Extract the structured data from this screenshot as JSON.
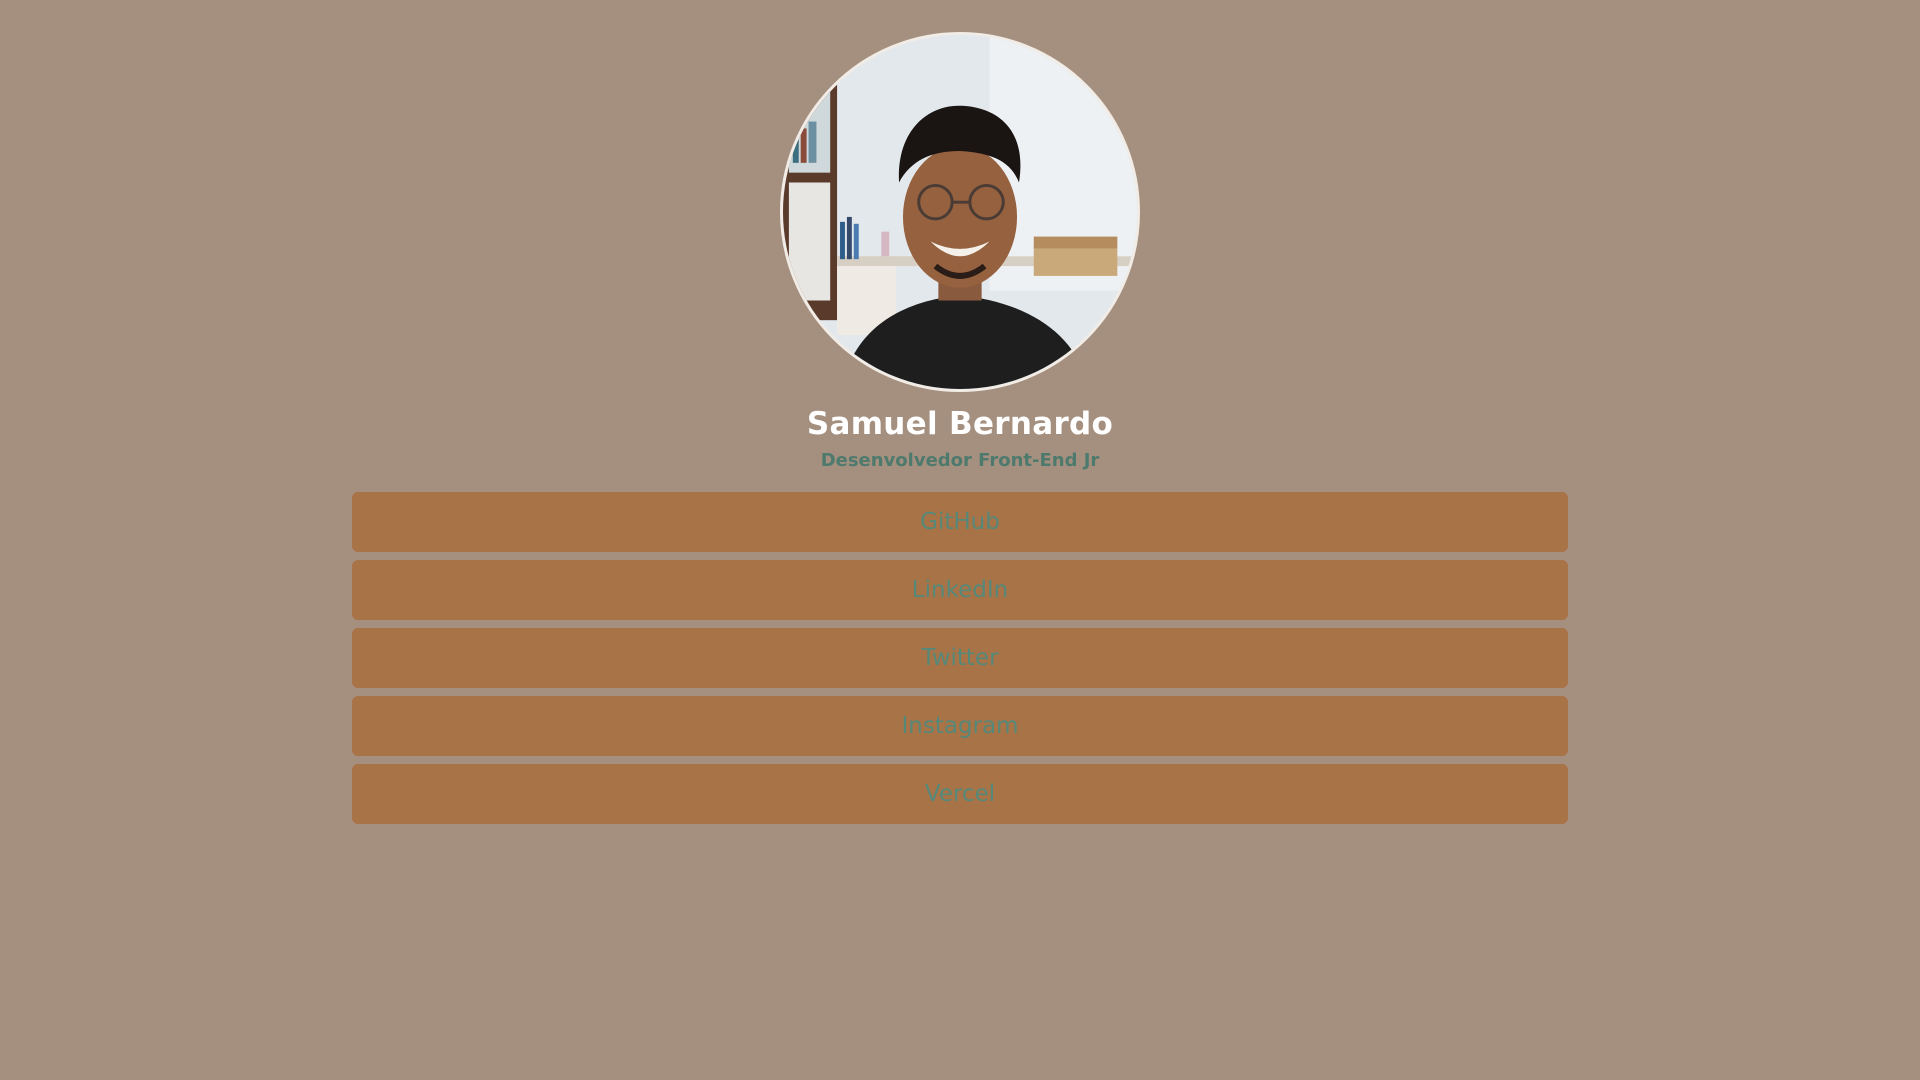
{
  "profile": {
    "name": "Samuel Bernardo",
    "role": "Desenvolvedor Front-End Jr",
    "avatar_icon": "avatar"
  },
  "links": [
    {
      "label": "GitHub"
    },
    {
      "label": "LinkedIn"
    },
    {
      "label": "Twitter"
    },
    {
      "label": "Instagram"
    },
    {
      "label": "Vercel"
    }
  ],
  "colors": {
    "background": "#a5907f",
    "button": "#a87447",
    "button_text": "#56887a",
    "name_text": "#ffffff",
    "role_text": "#4e7a6e"
  }
}
